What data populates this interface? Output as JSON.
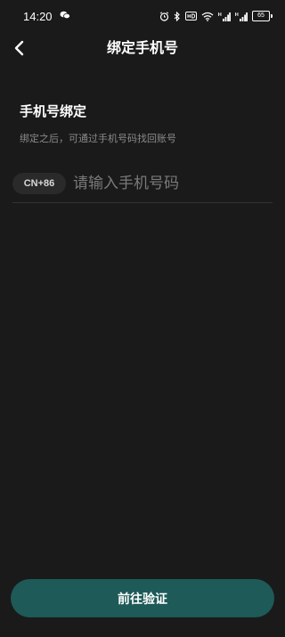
{
  "status_bar": {
    "time": "14:20",
    "battery": "65",
    "icons": [
      "wechat-icon",
      "alarm-icon",
      "bluetooth-icon",
      "hd-icon",
      "wifi-icon",
      "signal-icon",
      "signal-icon-2",
      "battery-icon"
    ]
  },
  "header": {
    "title": "绑定手机号"
  },
  "section": {
    "title": "手机号绑定",
    "hint": "绑定之后，可通过手机号码找回账号"
  },
  "phone": {
    "country_code": "CN+86",
    "placeholder": "请输入手机号码",
    "value": ""
  },
  "actions": {
    "verify_label": "前往验证"
  },
  "colors": {
    "background": "#1a1a1a",
    "button": "#1d5a58",
    "hint": "#8a8a8a",
    "placeholder": "#7a7a7a"
  }
}
